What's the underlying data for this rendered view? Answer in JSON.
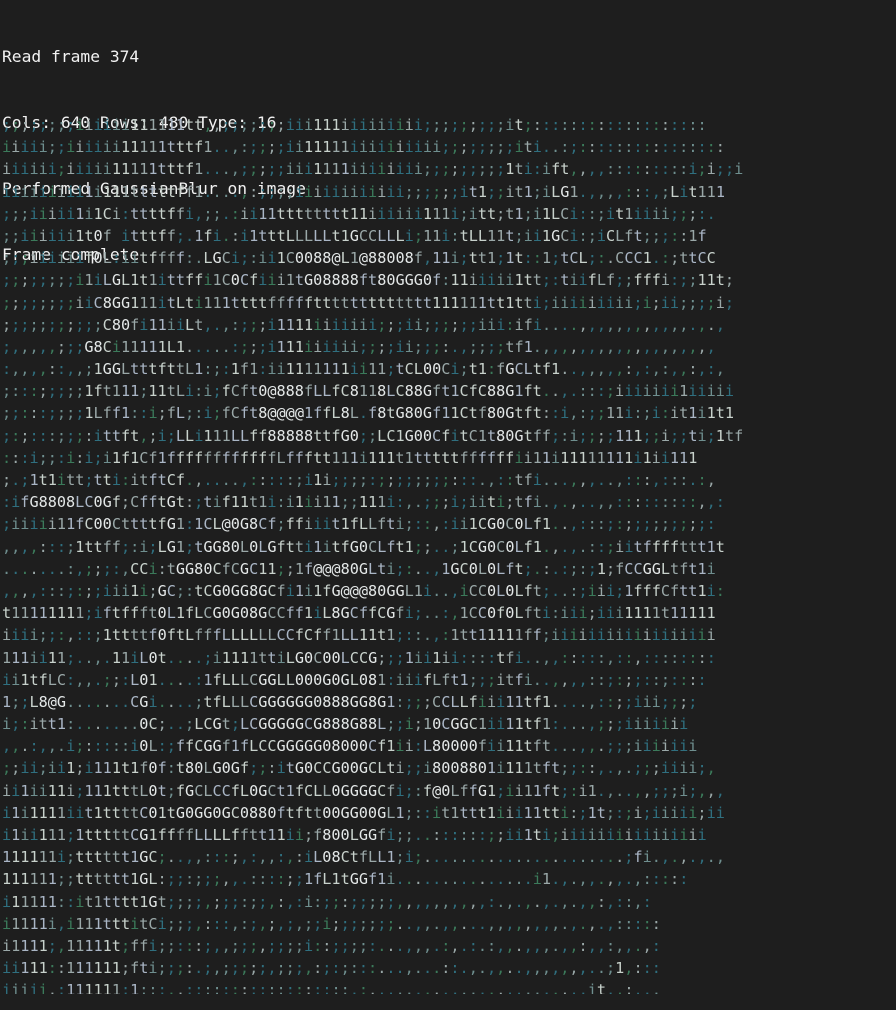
{
  "terminal": {
    "output_lines": [
      "Read frame 374",
      "Cols: 640 Rows: 480 Type: 16",
      "Performed GaussianBlur on image",
      "Frame complete"
    ],
    "colors": {
      "background": "#1e1e1e",
      "text": "#f2f2f2"
    }
  },
  "ascii_frame": {
    "palette": [
      "#2f6f7f",
      "#6f8f8f",
      "#c8d2cc",
      "#9aa8a8",
      "#3b7a5a",
      "#aab6c6",
      "#e4e8e8"
    ],
    "lines": [
      ";;;;;;;;iiiiii111111tt,,;;;;;;;iii111iiiiiiiii;;;;;;;;;it;:::::::::::::::::::",
      "iiiii;;iiiiii11111tttf1..,:;;;;ii11111iiiiiiiiii;;;;;;;;iti..:;::::::::::::::::",
      "iiiiii;iiiii11111tttf1...,;;;;;iii1111iiiiiiii;;;;;;;;;1ti:ift,,,,:::::::::i;i;;i",
      "iiiiiiiii1i111tttttff1....,:;;;;iiiiiiiiiiii;;;;;;it1;;it1;iLG1.,,,,:::,;Lit111",
      ";;;iiiii1i1Ci:ttttffi,;;.:ii11tttttttt11iiiiii111i;itt;t1;i1LCi::;it1iiii;;;:.",
      ";;iiiiii1t0f itttff;.1fi.:i1tttLLLLLt1GCCLLLi;11i:tLL11t;ii1GCi:;iCLft;;;::1f",
      ";;;iiiiiif0L:iitffff:.LGCi;:ii1C0088@L1@88008f,11i;tt1;1t::1;tCL;:.CCC1.:;ttCC",
      ";;;;;;;;i1iLGL1t1ittffi1C0Cfiii1tG08888ft80GGG0f:11iiiii1tt;:tiifLf;;fffi:;;11t;",
      ";;;;;;;;iiC8GG111itLti111ttttfffffttttttttttttt111111tt1tti;iiiiiiiii;i;ii;;;;i;",
      ";;;;;;;;;;;C80fi11iiLt,.,:;;;i1111iiiiiii;;;ii;;;;;;iii:ifi....,,,,,,,,,,,,.,.,",
      ";,,,,,;;;G8Ci11111L1.....:;;;i111iiiiii;;;;ii;;;:.,;;;;tf1.,,,,,,,,,,,,,,,,,,,",
      ":,,,,::,,;1GGLtttfttL1:;:1f1:ii1111111ii11;tCL00Ci;t1:fGCLtf1..,,,,,:,:,:,,:,:,",
      ";:::;;;;;1ft111;11tLi:i;fCft0@888fLLfC8118LC88Gft1CfC88G1ft..,.:::;iiiiiii1iiiii",
      ";;:::;;;;1Lff1::i;fL;:i;fCft8@@@@1ffL8L.f8tG80Gf11Ctf80Gtft::i,:;;11i:;i:it1i1t1",
      ";:;:::;;;:ittft,;i;LLi111LLff88888ttfG0;;LC1G00CfitC1t80Gtff;:i;;;;111;;i;;ti;1tf",
      ":::i;;:i:i;i1f1Cf1ffffffffffffLffftt111i111t1tttttffffffii11i11111111i1ii111",
      ";.;1t1itt;tti:itftCf.,....,:::::;i1i;;;;:;;;;;;;;:::.,::tfi...,,,..,:::,:::.:,",
      ":ifG8808LC0Gf;CfftGt:;tif11t1i:i1ii11;;111i:,.;;;i;iiti;tfi.,.,..,,:::::::::,,:",
      ";iiiii11fC00CttttfG1:1CL@0G8Cf;ffiiit1fLLfti;::,:ii1CG0C0Lf1..,:::;:;;;;;;;;;:",
      ",,,,:::;1ttff;:i;LG1;tGG80L0LGftti1itfG0CLft1;;..;1CG0C0Lf1.,.,.::;iitffffttt1t",
      ".......:,;;;:,CCi:tGG80CfCGC11;;1f@@@80GLti;:..,1GC0L0Lft;.:.:;:;1;fCCGGLtft1i",
      ",,,,:::;:;;iii1i;GC;:tCG0GG8GCfi1i1fG@@@80GGL1i..,iCC0L0Lft;..:;iii;1fffCftt1i:",
      "t11111111;iftffft0L1fLCG0G08GCCff1iL8GCffCGfi;..:,1CC0f0Lfti:iii;iii1111t11111",
      "iiii;;:,::;1ttttf0ftLfffLLLLLLCCfCff1LL11t1;::.,:1tt11111ff;iiiiiiiiiiiiiiiiii",
      "111ii11;..,.11iL0t....;i1111ttiLG0C00LCCG;;;1ii1ii::::tfi..,,:::::,::,::::::::",
      "ii1tfLC:,,.;;:L01....:1fLLLCGGLL000G0GL081:iiifLft1;;;itfi..,,,,::;:;;::;::::",
      "1;;L8@G.......CGi....;tfLLLCGGGGGG0888GG8G1:;;;CCLLfiii11tf1....,::;;iii;;;;",
      "i;:itt1:.......0C;..;LCGt;LCGGGGGCG888G88L;;i;10CGGC1ii11tf1:...,;;;iiiiiii",
      ",,.:,,.i;:::::i0L:;ffCGGf1fLCCGGGGG08000Cf1ii:L80000fii11tft...,,.;;;iiiiiii",
      ";;ii;ii1;i111t1f0f:t80LG0Gf;;:itG0CCG00GCLti;;i8008801i111tft;;::,.,.;;;iiii;,",
      "ii1ii11i;111tttL0t;fGCLCCfL0GCt1fCLL0GGGGCfi;:f@0LffG1;ii11ft;:i1.,..,,;;;i;,,,",
      "i1i1111iit1ttttC01tG0GG0GC0880ftftt00GG00GL1;::it1ttt1iii11tti:;1t;:;i;iiiii;ii",
      "i1ii111;1tttttCG1ffffLLLLfftt11ii;f800LGGfi;;..::::::;;ii1ti;iiiiiiiiiiiiiiii",
      "111111i;tttttt1GC;..,,:::;,:,,:,:iL08CtfLL1;i;......................;fi.,.,.,.,",
      "111111;;tttttt1GL:;;:;;;,,.::::;;1fL1tGGf1i...............i1.,.,,.,,.,:::::",
      "i11111::it1tttt1Gt;;;;,;;;:;;,:,:i:;;:;;;;;,,,,,,,,,,:.,.,.,.,.,,:,::,:",
      "i1111i,i111tttitCi;;;,:::,:;,;,;,;;i;;;;;;;..,,.,,...,,,,,,,,.,.,.,:::::",
      "i1111;,11111t;ffi;;:::;,,;;;,;;;;i::;;;;:...,,,.:,.:.:,,.,,,.,,:,,:,,.,:",
      "ii111::111111;fti;;;:.;,;;;;;,;;;,:;:;:::...,...::.,.,,..,,,,,,,..;1,:::",
      "iiiii,;111111;1;;;,,;:::;:;;;;:;;;;:;:,;.,,,,.,,.,.,,,.,.,,,.,,,it,,;.,,"
    ]
  }
}
